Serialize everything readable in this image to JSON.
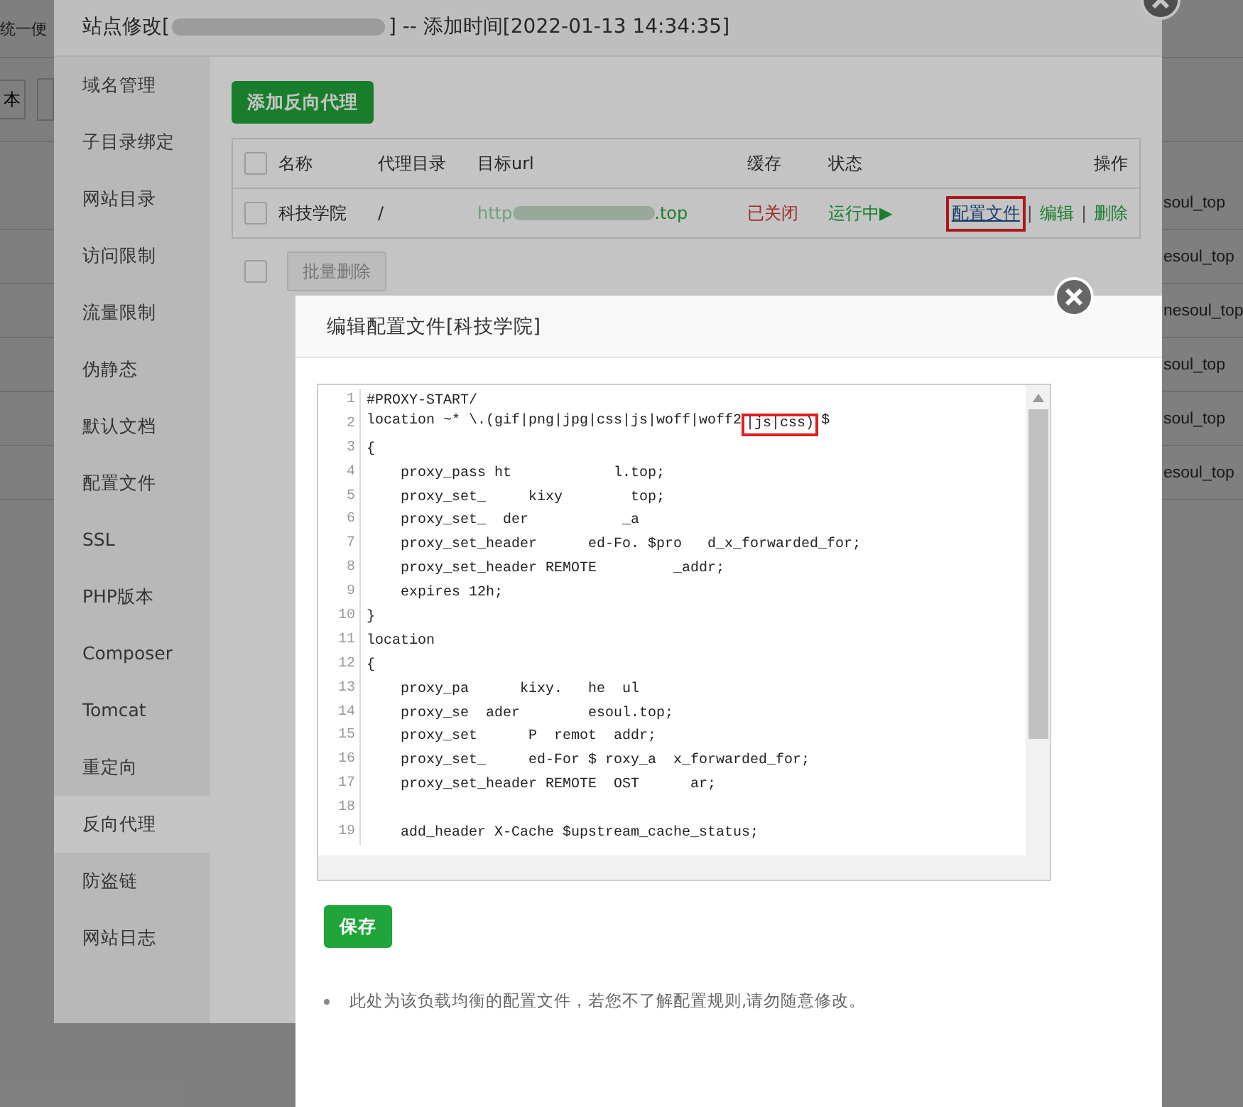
{
  "background_page": {
    "top_text": "统一便",
    "toolbar_button": "本",
    "row_texts": [
      "soul_top",
      "esoul_top",
      "nesoul_top",
      "soul_top",
      "soul_top",
      "esoul_top"
    ]
  },
  "site_dialog": {
    "title_prefix": "站点修改[",
    "title_suffix": "] -- 添加时间[2022-01-13 14:34:35]",
    "sidebar": [
      {
        "label": "域名管理",
        "selected": false
      },
      {
        "label": "子目录绑定",
        "selected": false
      },
      {
        "label": "网站目录",
        "selected": false
      },
      {
        "label": "访问限制",
        "selected": false
      },
      {
        "label": "流量限制",
        "selected": false
      },
      {
        "label": "伪静态",
        "selected": false
      },
      {
        "label": "默认文档",
        "selected": false
      },
      {
        "label": "配置文件",
        "selected": false
      },
      {
        "label": "SSL",
        "selected": false
      },
      {
        "label": "PHP版本",
        "selected": false
      },
      {
        "label": "Composer",
        "selected": false
      },
      {
        "label": "Tomcat",
        "selected": false
      },
      {
        "label": "重定向",
        "selected": false
      },
      {
        "label": "反向代理",
        "selected": true
      },
      {
        "label": "防盗链",
        "selected": false
      },
      {
        "label": "网站日志",
        "selected": false
      }
    ],
    "add_button": "添加反向代理",
    "table": {
      "header_checked": false,
      "columns": [
        "名称",
        "代理目录",
        "目标url",
        "缓存",
        "状态",
        "操作"
      ],
      "rows": [
        {
          "checked": false,
          "name": "科技学院",
          "dir": "/",
          "url_start": "http",
          "url_end": ".top",
          "cache": "已关闭",
          "status": "运行中▶",
          "separator": "|",
          "actions": [
            {
              "label": "配置文件",
              "highlighted": true
            },
            {
              "label": "编辑",
              "highlighted": false
            },
            {
              "label": "删除",
              "highlighted": false
            }
          ]
        }
      ]
    },
    "batch_checked": false,
    "batch_delete": "批量删除"
  },
  "config_dialog": {
    "title": "编辑配置文件[科技学院]",
    "lines": [
      {
        "no": "1",
        "text": "#PROXY-START/"
      },
      {
        "no": "2",
        "text": "location ~* \\.(gif|png|jpg|css|js|woff|woff2",
        "boxed": "|js|css)",
        "tail": "$"
      },
      {
        "no": "3",
        "text": "{"
      },
      {
        "no": "4",
        "text": "    proxy_pass ht            l.top;"
      },
      {
        "no": "5",
        "text": "    proxy_set_     kixy        top;"
      },
      {
        "no": "6",
        "text": "    proxy_set_  der           _a"
      },
      {
        "no": "7",
        "text": "    proxy_set_header      ed-Fo. $pro   d_x_forwarded_for;"
      },
      {
        "no": "8",
        "text": "    proxy_set_header REMOTE         _addr;"
      },
      {
        "no": "9",
        "text": "    expires 12h;"
      },
      {
        "no": "10",
        "text": "}"
      },
      {
        "no": "11",
        "text": "location"
      },
      {
        "no": "12",
        "text": "{"
      },
      {
        "no": "13",
        "text": "    proxy_pa      kixy.   he  ul"
      },
      {
        "no": "14",
        "text": "    proxy_se  ader        esoul.top;"
      },
      {
        "no": "15",
        "text": "    proxy_set      P  remot  addr;"
      },
      {
        "no": "16",
        "text": "    proxy_set_     ed-For $ roxy_a  x_forwarded_for;"
      },
      {
        "no": "17",
        "text": "    proxy_set_header REMOTE  OST      ar;"
      },
      {
        "no": "18"
      },
      {
        "no": "19",
        "text": "    add_header X-Cache $upstream_cache_status;"
      }
    ],
    "save_button": "保存",
    "note": "此处为该负载均衡的配置文件，若您不了解配置规则,请勿随意修改。"
  }
}
